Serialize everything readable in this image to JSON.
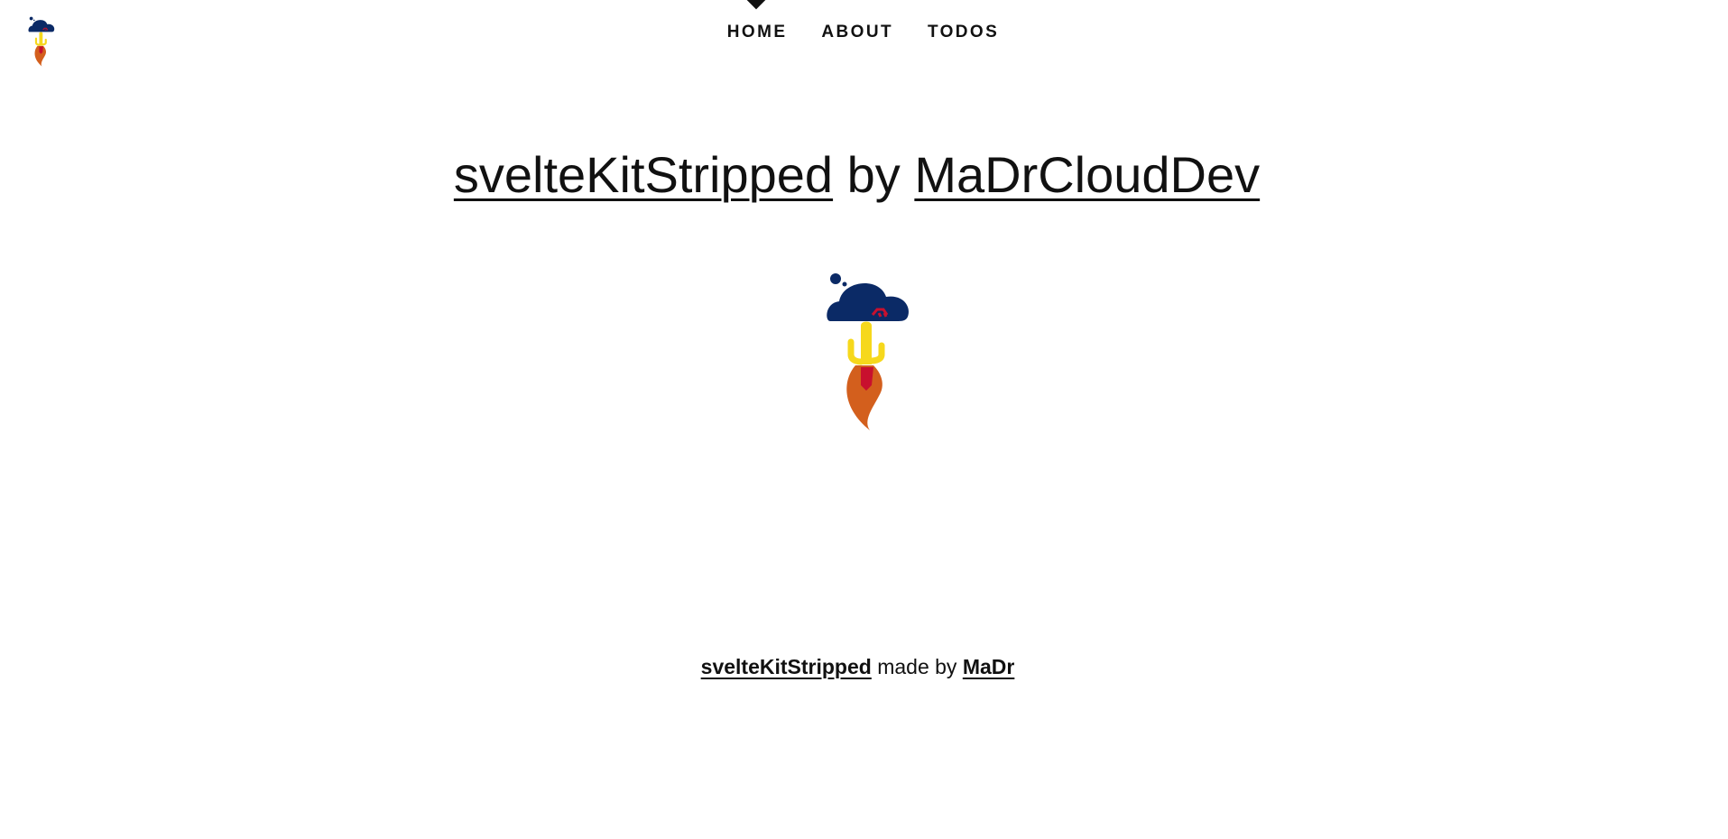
{
  "nav": {
    "items": [
      {
        "label": "Home",
        "active": true
      },
      {
        "label": "About",
        "active": false
      },
      {
        "label": "Todos",
        "active": false
      }
    ]
  },
  "headline": {
    "project_link": "svelteKitStripped",
    "connector": " by ",
    "author_link": "MaDrCloudDev"
  },
  "footer": {
    "project_link": "svelteKitStripped",
    "connector": " made by ",
    "author_link": "MaDr"
  },
  "logo": {
    "icon": "cloud-cactus-rocket-logo",
    "colors": {
      "cloud": "#0b2a66",
      "cactus": "#f6d81c",
      "flame": "#d35f1d",
      "accent": "#c8102e"
    }
  }
}
